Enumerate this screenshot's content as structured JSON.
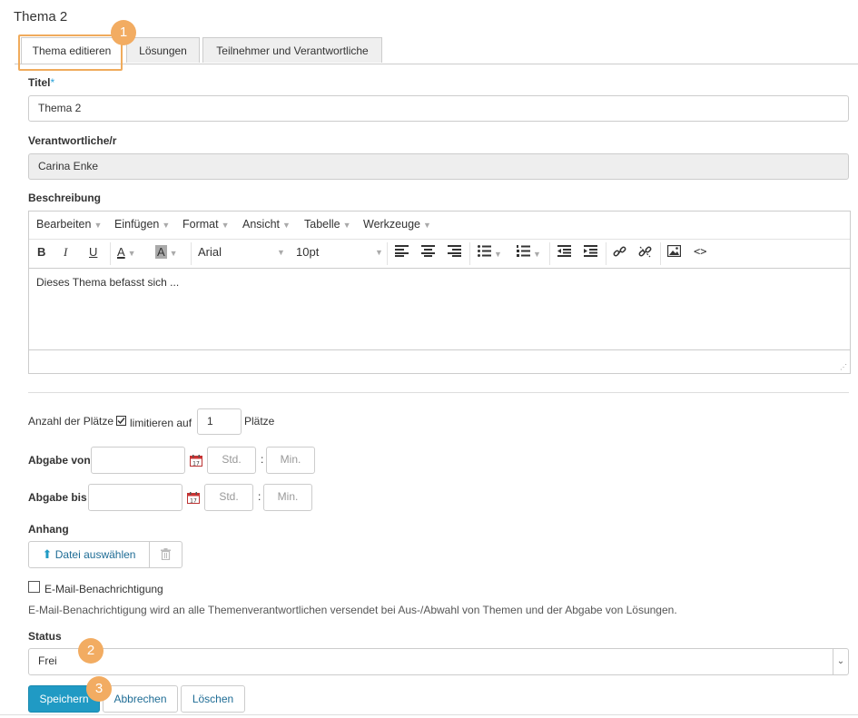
{
  "page_title": "Thema 2",
  "tabs": [
    {
      "label": "Thema editieren",
      "active": true
    },
    {
      "label": "Lösungen"
    },
    {
      "label": "Teilnehmer und Verantwortliche"
    }
  ],
  "badges": [
    "1",
    "2",
    "3"
  ],
  "form": {
    "title_label": "Titel",
    "title_required_mark": "*",
    "title_value": "Thema 2",
    "responsible_label": "Verantwortliche/r",
    "responsible_value": "Carina Enke",
    "description_label": "Beschreibung",
    "description_text": "Dieses Thema befasst sich  ...",
    "seats_label": "Anzahl der Plätze",
    "seats_limit_label": "limitieren auf",
    "seats_value": "1",
    "seats_unit": "Plätze",
    "submit_from_label": "Abgabe von",
    "submit_until_label": "Abgabe bis",
    "hour_placeholder": "Std.",
    "minute_placeholder": "Min.",
    "time_separator": ":",
    "attachment_label": "Anhang",
    "file_button": "Datei auswählen",
    "email_checkbox_label": "E-Mail-Benachrichtigung",
    "email_hint": "E-Mail-Benachrichtigung wird an alle Themenverantwortlichen versendet bei Aus-/Abwahl von Themen und der Abgabe von Lösungen.",
    "status_label": "Status",
    "status_value": "Frei"
  },
  "editor": {
    "menus": [
      "Bearbeiten",
      "Einfügen",
      "Format",
      "Ansicht",
      "Tabelle",
      "Werkzeuge"
    ],
    "font_family": "Arial",
    "font_size": "10pt",
    "bold": "B",
    "italic": "I",
    "underline": "U"
  },
  "actions": {
    "save": "Speichern",
    "cancel": "Abbrechen",
    "delete": "Löschen"
  },
  "colors": {
    "accent": "#209ac4",
    "highlight": "#f2ac62"
  }
}
